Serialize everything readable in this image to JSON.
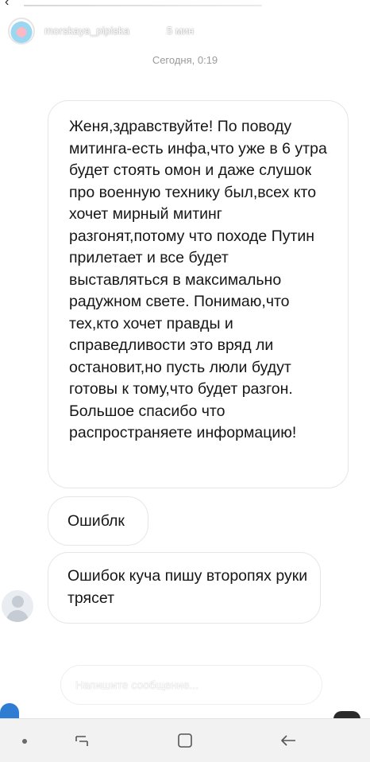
{
  "story_header": {
    "username": "morskaya_pipiska",
    "time_ago": "5 мин"
  },
  "date_separator": "Сегодня, 0:19",
  "messages": [
    {
      "text": "Женя,здравствуйте! По поводу митинга-есть инфа,что уже в 6 утра будет стоять омон и даже слушок про военную технику был,всех кто хочет мирный митинг разгонят,потому что походе Путин прилетает и все будет выставляться в максимально радужном свете. Понимаю,что тех,кто хочет правды и справедливости это вряд ли остановит,но пусть люли будут готовы к тому,что будет разгон. Большое спасибо что распространяете информацию!"
    },
    {
      "text": "Ошиблк"
    },
    {
      "text": "Ошибок куча пишу второпях руки трясет"
    }
  ],
  "composer": {
    "placeholder": "Напишите сообщение..."
  },
  "icons": {
    "back": "chevron-left-icon",
    "camera": "camera-icon",
    "menu": "more-vertical-icon",
    "send": "send-icon",
    "nav_recent": "recent-apps-icon",
    "nav_home": "home-icon",
    "nav_back": "back-icon"
  },
  "colors": {
    "bubble_border": "#e6e6e6",
    "date_text": "#9b9b9b",
    "navbar_bg": "#f2f2f2"
  }
}
